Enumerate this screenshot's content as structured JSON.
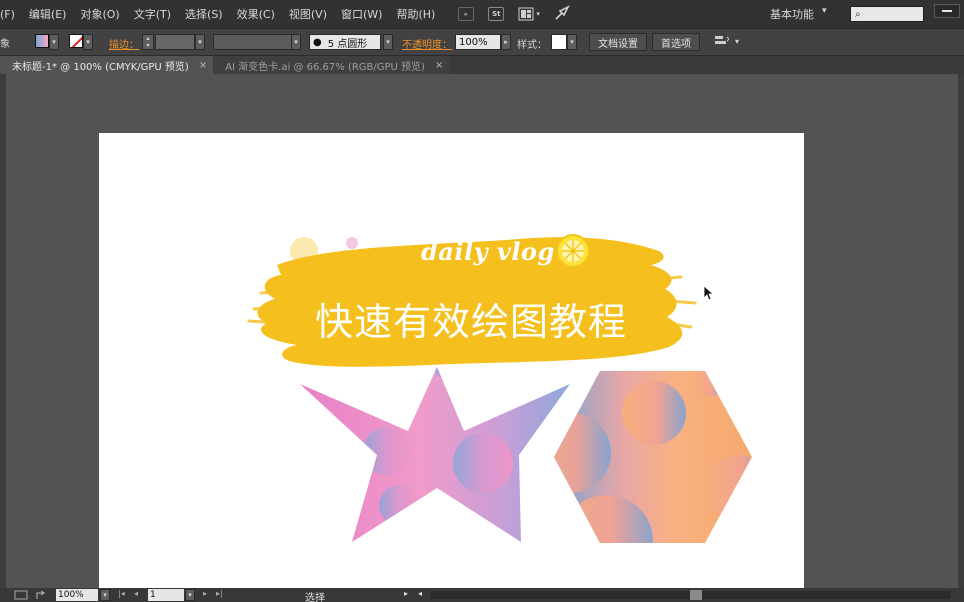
{
  "menu": {
    "items": [
      "(F)",
      "编辑(E)",
      "对象(O)",
      "文字(T)",
      "选择(S)",
      "效果(C)",
      "视图(V)",
      "窗口(W)",
      "帮助(H)"
    ],
    "st_label": "St",
    "workspace": "基本功能",
    "workspace_arrow": "▾",
    "search_icon": "⌕"
  },
  "control": {
    "left_glyph": "象",
    "stroke_label": "描边：",
    "brush_label": "5 点圆形",
    "opacity_label": "不透明度：",
    "opacity_value": "100%",
    "style_label": "样式：",
    "doc_setup_button": "文档设置",
    "preferences_button": "首选项"
  },
  "tabs": [
    {
      "label": "未标题-1* @ 100% (CMYK/GPU 预览)",
      "close": "×"
    },
    {
      "label": "AI 渐变色卡.ai @ 66.67% (RGB/GPU 预览)",
      "close": "×"
    }
  ],
  "artwork": {
    "banner_subtitle": "daily vlog",
    "banner_title": "快速有效绘图教程",
    "colors": {
      "brush_yellow": "#f5bf1e",
      "star_pink": "#e98fc9",
      "star_blue": "#9aa8dc",
      "hex_blue": "#7fa4d2",
      "hex_peach": "#f8b07a"
    }
  },
  "status": {
    "zoom": "100%",
    "page": "1",
    "tool": "选择"
  }
}
